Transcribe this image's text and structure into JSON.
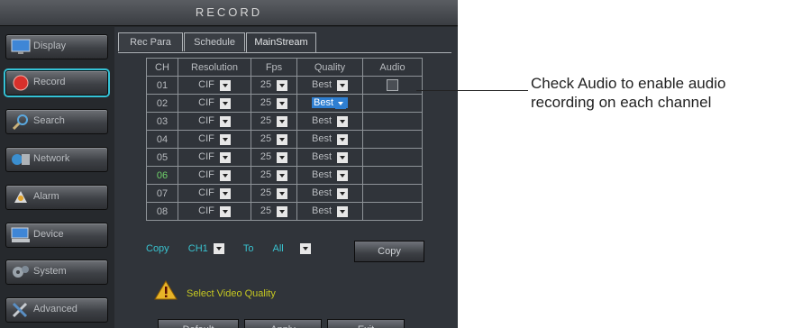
{
  "window": {
    "title": "RECORD"
  },
  "sidebar": {
    "items": [
      {
        "label": "Display",
        "icon": "monitor-icon",
        "active": false
      },
      {
        "label": "Record",
        "icon": "record-icon",
        "active": true
      },
      {
        "label": "Search",
        "icon": "magnifier-icon",
        "active": false
      },
      {
        "label": "Network",
        "icon": "network-icon",
        "active": false
      },
      {
        "label": "Alarm",
        "icon": "alarm-icon",
        "active": false
      },
      {
        "label": "Device",
        "icon": "device-icon",
        "active": false
      },
      {
        "label": "System",
        "icon": "gears-icon",
        "active": false
      },
      {
        "label": "Advanced",
        "icon": "tools-icon",
        "active": false
      }
    ]
  },
  "tabs": [
    {
      "label": "Rec Para",
      "active": false
    },
    {
      "label": "Schedule",
      "active": false
    },
    {
      "label": "MainStream",
      "active": true
    }
  ],
  "table": {
    "headers": [
      "CH",
      "Resolution",
      "Fps",
      "Quality",
      "Audio"
    ],
    "rows": [
      {
        "ch": "01",
        "resolution": "CIF",
        "fps": "25",
        "quality": "Best",
        "audio": true
      },
      {
        "ch": "02",
        "resolution": "CIF",
        "fps": "25",
        "quality": "Best",
        "audio": false
      },
      {
        "ch": "03",
        "resolution": "CIF",
        "fps": "25",
        "quality": "Best",
        "audio": false
      },
      {
        "ch": "04",
        "resolution": "CIF",
        "fps": "25",
        "quality": "Best",
        "audio": false
      },
      {
        "ch": "05",
        "resolution": "CIF",
        "fps": "25",
        "quality": "Best",
        "audio": false
      },
      {
        "ch": "06",
        "resolution": "CIF",
        "fps": "25",
        "quality": "Best",
        "audio": false
      },
      {
        "ch": "07",
        "resolution": "CIF",
        "fps": "25",
        "quality": "Best",
        "audio": false
      },
      {
        "ch": "08",
        "resolution": "CIF",
        "fps": "25",
        "quality": "Best",
        "audio": false
      }
    ]
  },
  "copy": {
    "label": "Copy",
    "from": "CH1",
    "to_label": "To",
    "to": "All",
    "button": "Copy"
  },
  "message": "Select Video Quality",
  "buttons": {
    "default": "Default",
    "apply": "Apply",
    "exit": "Exit"
  },
  "annotation": {
    "line1": "Check Audio to enable audio",
    "line2": "recording on each channel"
  },
  "colors": {
    "accent": "#35c2d6",
    "cyan_text": "#39c3d0",
    "green_text": "#6fd36a",
    "selected": "#2f7fd1",
    "message": "#c6c822"
  }
}
